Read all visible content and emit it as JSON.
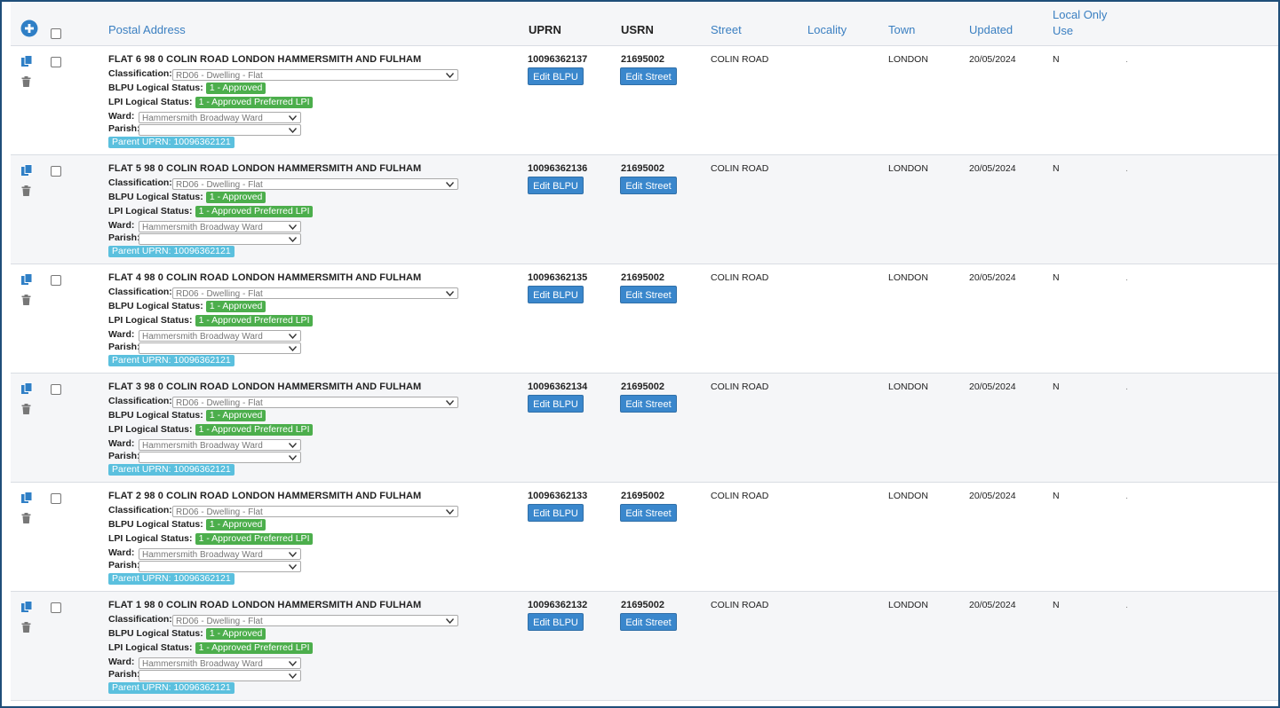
{
  "header": {
    "postal_address": "Postal Address",
    "uprn": "UPRN",
    "usrn": "USRN",
    "street": "Street",
    "locality": "Locality",
    "town": "Town",
    "updated": "Updated",
    "local_only_use": "Local Only Use"
  },
  "labels": {
    "classification": "Classification:",
    "blpu_status": "BLPU Logical Status:",
    "lpi_status": "LPI Logical Status:",
    "ward": "Ward:",
    "parish": "Parish:",
    "edit_blpu": "Edit BLPU",
    "edit_street": "Edit Street"
  },
  "colors": {
    "accent": "#3a7fc1",
    "approved_green": "#4cae4c",
    "parent_badge": "#5bc0de",
    "button_blue": "#3a87cc",
    "frame_border": "#1f4e79"
  },
  "icons": [
    "add-circle-icon",
    "copy-icon",
    "trash-icon",
    "chevron-down-icon"
  ],
  "rows": [
    {
      "address": "FLAT 6 98 0 COLIN ROAD LONDON HAMMERSMITH AND FULHAM",
      "classification": "RD06 - Dwelling - Flat",
      "blpu_status": "1 - Approved",
      "lpi_status": "1 - Approved Preferred LPI",
      "ward": "Hammersmith Broadway Ward",
      "parish": "",
      "parent": "Parent UPRN: 10096362121",
      "uprn": "10096362137",
      "usrn": "21695002",
      "street": "COLIN ROAD",
      "locality": "",
      "town": "LONDON",
      "updated": "20/05/2024",
      "local_only": "N",
      "extra": "."
    },
    {
      "address": "FLAT 5 98 0 COLIN ROAD LONDON HAMMERSMITH AND FULHAM",
      "classification": "RD06 - Dwelling - Flat",
      "blpu_status": "1 - Approved",
      "lpi_status": "1 - Approved Preferred LPI",
      "ward": "Hammersmith Broadway Ward",
      "parish": "",
      "parent": "Parent UPRN: 10096362121",
      "uprn": "10096362136",
      "usrn": "21695002",
      "street": "COLIN ROAD",
      "locality": "",
      "town": "LONDON",
      "updated": "20/05/2024",
      "local_only": "N",
      "extra": "."
    },
    {
      "address": "FLAT 4 98 0 COLIN ROAD LONDON HAMMERSMITH AND FULHAM",
      "classification": "RD06 - Dwelling - Flat",
      "blpu_status": "1 - Approved",
      "lpi_status": "1 - Approved Preferred LPI",
      "ward": "Hammersmith Broadway Ward",
      "parish": "",
      "parent": "Parent UPRN: 10096362121",
      "uprn": "10096362135",
      "usrn": "21695002",
      "street": "COLIN ROAD",
      "locality": "",
      "town": "LONDON",
      "updated": "20/05/2024",
      "local_only": "N",
      "extra": "."
    },
    {
      "address": "FLAT 3 98 0 COLIN ROAD LONDON HAMMERSMITH AND FULHAM",
      "classification": "RD06 - Dwelling - Flat",
      "blpu_status": "1 - Approved",
      "lpi_status": "1 - Approved Preferred LPI",
      "ward": "Hammersmith Broadway Ward",
      "parish": "",
      "parent": "Parent UPRN: 10096362121",
      "uprn": "10096362134",
      "usrn": "21695002",
      "street": "COLIN ROAD",
      "locality": "",
      "town": "LONDON",
      "updated": "20/05/2024",
      "local_only": "N",
      "extra": "."
    },
    {
      "address": "FLAT 2 98 0 COLIN ROAD LONDON HAMMERSMITH AND FULHAM",
      "classification": "RD06 - Dwelling - Flat",
      "blpu_status": "1 - Approved",
      "lpi_status": "1 - Approved Preferred LPI",
      "ward": "Hammersmith Broadway Ward",
      "parish": "",
      "parent": "Parent UPRN: 10096362121",
      "uprn": "10096362133",
      "usrn": "21695002",
      "street": "COLIN ROAD",
      "locality": "",
      "town": "LONDON",
      "updated": "20/05/2024",
      "local_only": "N",
      "extra": "."
    },
    {
      "address": "FLAT 1 98 0 COLIN ROAD LONDON HAMMERSMITH AND FULHAM",
      "classification": "RD06 - Dwelling - Flat",
      "blpu_status": "1 - Approved",
      "lpi_status": "1 - Approved Preferred LPI",
      "ward": "Hammersmith Broadway Ward",
      "parish": "",
      "parent": "Parent UPRN: 10096362121",
      "uprn": "10096362132",
      "usrn": "21695002",
      "street": "COLIN ROAD",
      "locality": "",
      "town": "LONDON",
      "updated": "20/05/2024",
      "local_only": "N",
      "extra": "."
    }
  ]
}
